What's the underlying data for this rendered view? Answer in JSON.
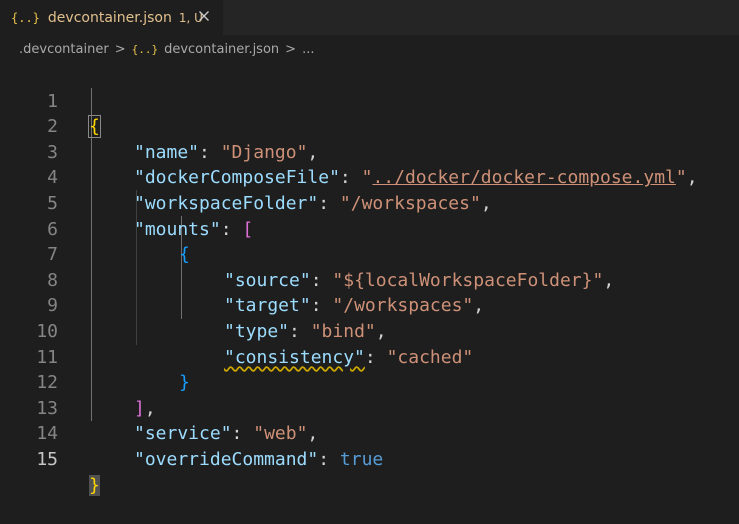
{
  "tab": {
    "icon_text": "{..}",
    "label": "devcontainer.json",
    "status": "1, U"
  },
  "breadcrumb": {
    "folder": ".devcontainer",
    "separator": ">",
    "file_icon_text": "{..}",
    "file": "devcontainer.json",
    "ellipsis": "..."
  },
  "editor": {
    "line_numbers": [
      "1",
      "2",
      "3",
      "4",
      "5",
      "6",
      "7",
      "8",
      "9",
      "10",
      "11",
      "12",
      "13",
      "14",
      "15"
    ],
    "active_line": "15",
    "tokens": {
      "l1_open": "{",
      "l2_key": "\"name\"",
      "l2_colon": ": ",
      "l2_val": "\"Django\"",
      "l2_comma": ",",
      "l3_key": "\"dockerComposeFile\"",
      "l3_colon": ": ",
      "l3_q1": "\"",
      "l3_val": "../docker/docker-compose.yml",
      "l3_q2": "\"",
      "l3_comma": ",",
      "l4_key": "\"workspaceFolder\"",
      "l4_colon": ": ",
      "l4_val": "\"/workspaces\"",
      "l4_comma": ",",
      "l5_key": "\"mounts\"",
      "l5_colon": ": ",
      "l5_open": "[",
      "l6_open": "{",
      "l7_key": "\"source\"",
      "l7_colon": ": ",
      "l7_val": "\"${localWorkspaceFolder}\"",
      "l7_comma": ",",
      "l8_key": "\"target\"",
      "l8_colon": ": ",
      "l8_val": "\"/workspaces\"",
      "l8_comma": ",",
      "l9_key": "\"type\"",
      "l9_colon": ": ",
      "l9_val": "\"bind\"",
      "l9_comma": ",",
      "l10_key": "\"consistency\"",
      "l10_colon": ": ",
      "l10_val": "\"cached\"",
      "l11_close": "}",
      "l12_close": "]",
      "l12_comma": ",",
      "l13_key": "\"service\"",
      "l13_colon": ": ",
      "l13_val": "\"web\"",
      "l13_comma": ",",
      "l14_key": "\"overrideCommand\"",
      "l14_colon": ": ",
      "l14_val": "true",
      "l15_close": "}"
    }
  },
  "colors": {
    "background": "#1e1e1e",
    "key": "#9cdcfe",
    "string": "#ce9178",
    "bracket_level1": "#ffd700",
    "bracket_level2": "#da70d6",
    "bracket_level3": "#179fff",
    "keyword": "#569cd6",
    "modified_tab": "#e2c08d"
  }
}
